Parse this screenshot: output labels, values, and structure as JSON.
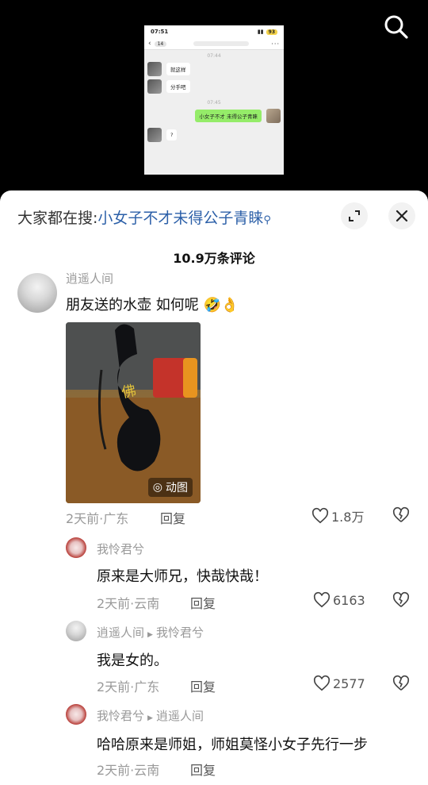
{
  "chat_screenshot": {
    "status_time": "07:51",
    "battery": "93",
    "unread_count": "14",
    "time1": "07:44",
    "msg1": "就这样",
    "msg2": "分手吧",
    "time2": "07:45",
    "msg3": "小女子不才 未得公子青睐",
    "msg4": "?"
  },
  "sheet": {
    "search_prefix": "大家都在搜:",
    "search_keyword": "小女子不才未得公子青睐",
    "comment_count": "10.9万条评论"
  },
  "comments": [
    {
      "author": "逍遥人间",
      "text": "朋友送的水壶 如何呢",
      "emoji": "🤣👌",
      "media_badge": "动图",
      "meta": "2天前·广东",
      "reply_label": "回复",
      "likes": "1.8万"
    },
    {
      "author": "我怜君兮",
      "text": "原来是大师兄，快哉快哉！",
      "meta": "2天前·云南",
      "reply_label": "回复",
      "likes": "6163"
    },
    {
      "author": "逍遥人间",
      "reply_to": "我怜君兮",
      "text": "我是女的。",
      "meta": "2天前·广东",
      "reply_label": "回复",
      "likes": "2577"
    },
    {
      "author": "我怜君兮",
      "reply_to": "逍遥人间",
      "text": "哈哈原来是师姐，师姐莫怪小女子先行一步",
      "meta": "2天前·云南",
      "reply_label": "回复"
    }
  ]
}
